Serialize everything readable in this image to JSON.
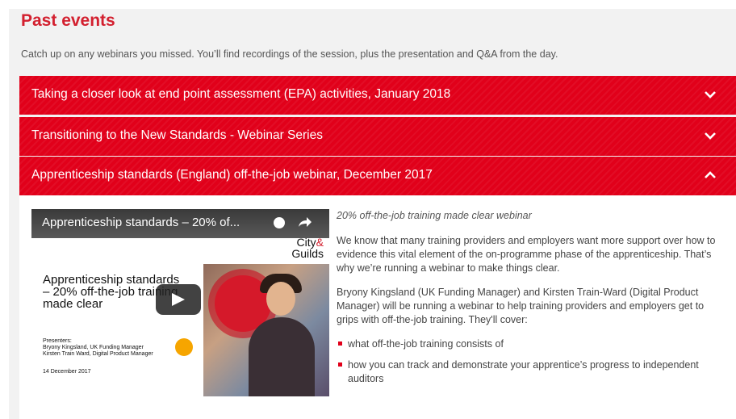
{
  "section": {
    "title": "Past events",
    "intro": "Catch up on any webinars you missed. You’ll find recordings of the session, plus the presentation and Q&A from the day."
  },
  "accordion": [
    {
      "label": "Taking a closer look at end point assessment (EPA) activities, January 2018",
      "icon": "chevron-down-icon"
    },
    {
      "label": "Transitioning to the New Standards - Webinar Series",
      "icon": "chevron-down-icon"
    },
    {
      "label": "Apprenticeship standards (England) off-the-job webinar, December 2017",
      "icon": "chevron-up-icon"
    }
  ],
  "video": {
    "title": "Apprenticeship standards – 20% of...",
    "logo_top": "City",
    "logo_amp": "&",
    "logo_bottom": "Guilds",
    "slide_heading": "Apprenticeship standards – 20% off-the-job training made clear",
    "presenters_label": "Presenters:",
    "presenter_1": "Bryony Kingsland, UK Funding Manager",
    "presenter_2": "Kirsten Train Ward, Digital Product Manager",
    "date": "14 December 2017"
  },
  "details": {
    "subtitle": "20% off-the-job training made clear webinar",
    "para1": "We know that many training providers and employers want more support over how to evidence this vital element of the on-programme phase of the apprenticeship. That’s why we’re running a webinar to make things clear.",
    "para2": "Bryony Kingsland (UK Funding Manager) and Kirsten Train-Ward (Digital Product Manager) will be running a webinar to help training providers and employers get to grips with off-the-job training. They'll cover:",
    "bullets": [
      "what off-the-job training consists of",
      "how you can track and demonstrate your apprentice’s progress to independent auditors"
    ]
  },
  "colors": {
    "accent": "#e1001a",
    "title_red": "#d3202f",
    "panel_bg": "#f2f2f2"
  }
}
